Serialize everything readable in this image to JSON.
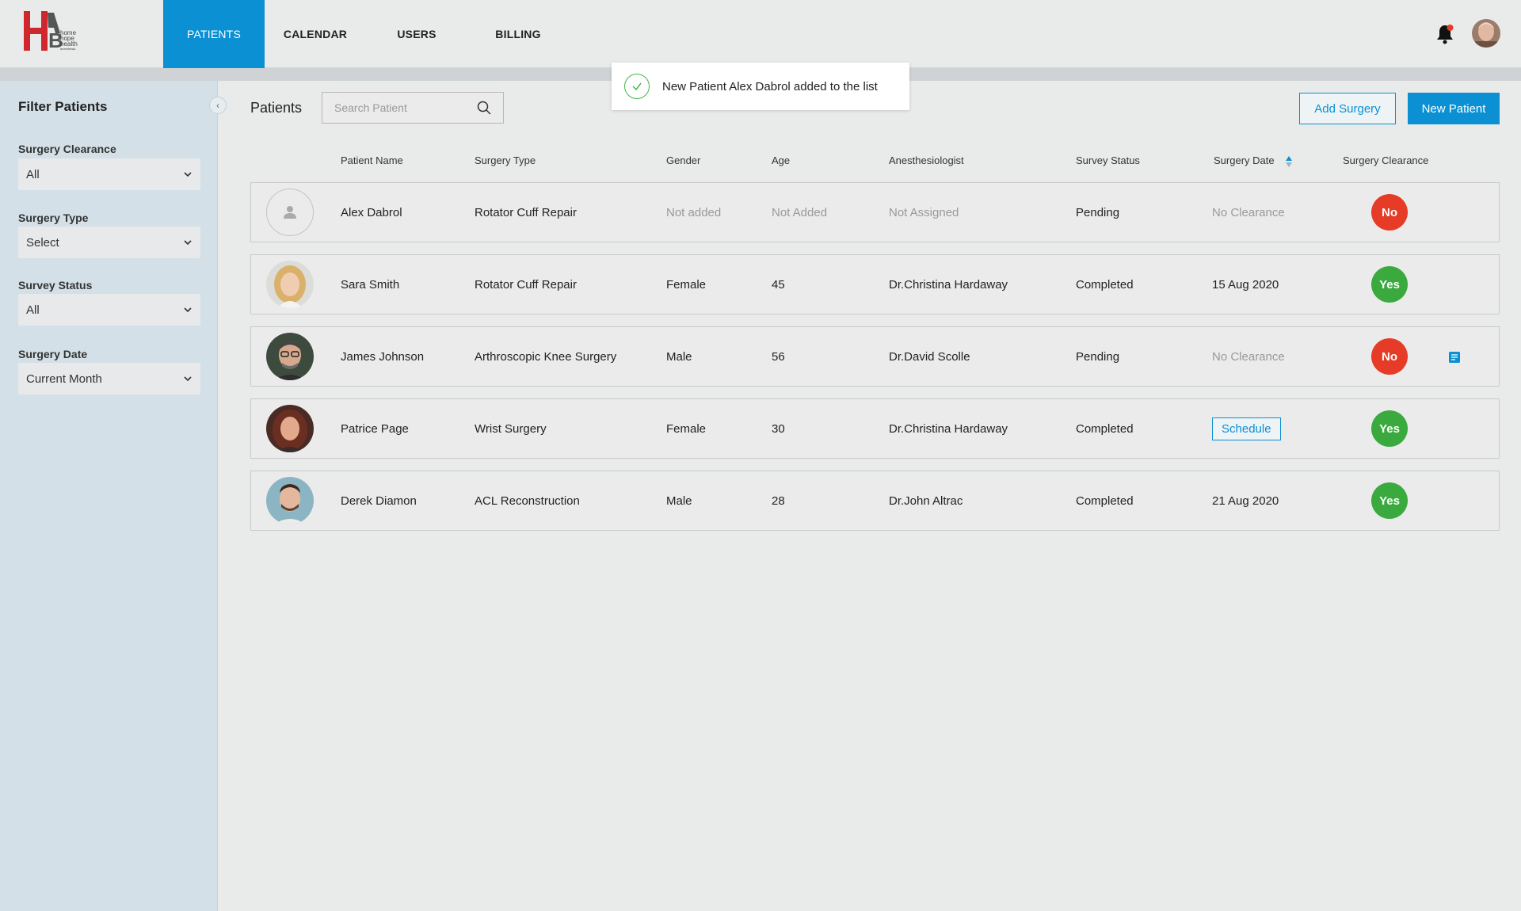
{
  "nav": {
    "items": [
      {
        "label": "PATIENTS",
        "active": true,
        "width": 128
      },
      {
        "label": "CALENDAR",
        "active": false,
        "width": 128
      },
      {
        "label": "USERS",
        "active": false,
        "width": 128
      },
      {
        "label": "BILLING",
        "active": false,
        "width": 128
      }
    ]
  },
  "logo": {
    "letters": "HAB",
    "lines": [
      "home",
      "hope",
      "health",
      "anesthesia"
    ]
  },
  "sidebar": {
    "title": "Filter Patients",
    "filters": [
      {
        "label": "Surgery Clearance",
        "value": "All"
      },
      {
        "label": "Surgery Type",
        "value": "Select"
      },
      {
        "label": "Survey Status",
        "value": "All"
      },
      {
        "label": "Surgery Date",
        "value": "Current Month"
      }
    ]
  },
  "main": {
    "title": "Patients",
    "search_placeholder": "Search Patient",
    "toast": "New Patient Alex Dabrol added to the list",
    "add_surgery": "Add Surgery",
    "new_patient": "New Patient"
  },
  "table": {
    "headers": [
      "Patient Name",
      "Surgery Type",
      "Gender",
      "Age",
      "Anesthesiologist",
      "Survey Status",
      "Surgery Date",
      "Surgery Clearance"
    ],
    "rows": [
      {
        "name": "Alex Dabrol",
        "surgery": "Rotator Cuff Repair",
        "gender": "Not added",
        "age": "Not Added",
        "anesthesiologist": "Not Assigned",
        "status": "Pending",
        "date": "No Clearance",
        "clearance": "No",
        "avatar": "placeholder"
      },
      {
        "name": "Sara Smith",
        "surgery": "Rotator Cuff Repair",
        "gender": "Female",
        "age": "45",
        "anesthesiologist": "Dr.Christina Hardaway",
        "status": "Completed",
        "date": "15 Aug 2020",
        "clearance": "Yes",
        "avatar": "woman-blonde"
      },
      {
        "name": "James Johnson",
        "surgery": "Arthroscopic Knee Surgery",
        "gender": "Male",
        "age": "56",
        "anesthesiologist": "Dr.David Scolle",
        "status": "Pending",
        "date": "No Clearance",
        "clearance": "No",
        "avatar": "man-glasses"
      },
      {
        "name": "Patrice Page",
        "surgery": "Wrist Surgery",
        "gender": "Female",
        "age": "30",
        "anesthesiologist": "Dr.Christina Hardaway",
        "status": "Completed",
        "date": "Schedule",
        "clearance": "Yes",
        "avatar": "woman-brunette"
      },
      {
        "name": "Derek Diamon",
        "surgery": "ACL Reconstruction",
        "gender": "Male",
        "age": "28",
        "anesthesiologist": "Dr.John Altrac",
        "status": "Completed",
        "date": "21 Aug 2020",
        "clearance": "Yes",
        "avatar": "man-young"
      }
    ]
  },
  "colors": {
    "accent": "#0a90d3",
    "no": "#e63b27",
    "yes": "#3aaa3e",
    "sidebar": "#d4e0e7"
  }
}
